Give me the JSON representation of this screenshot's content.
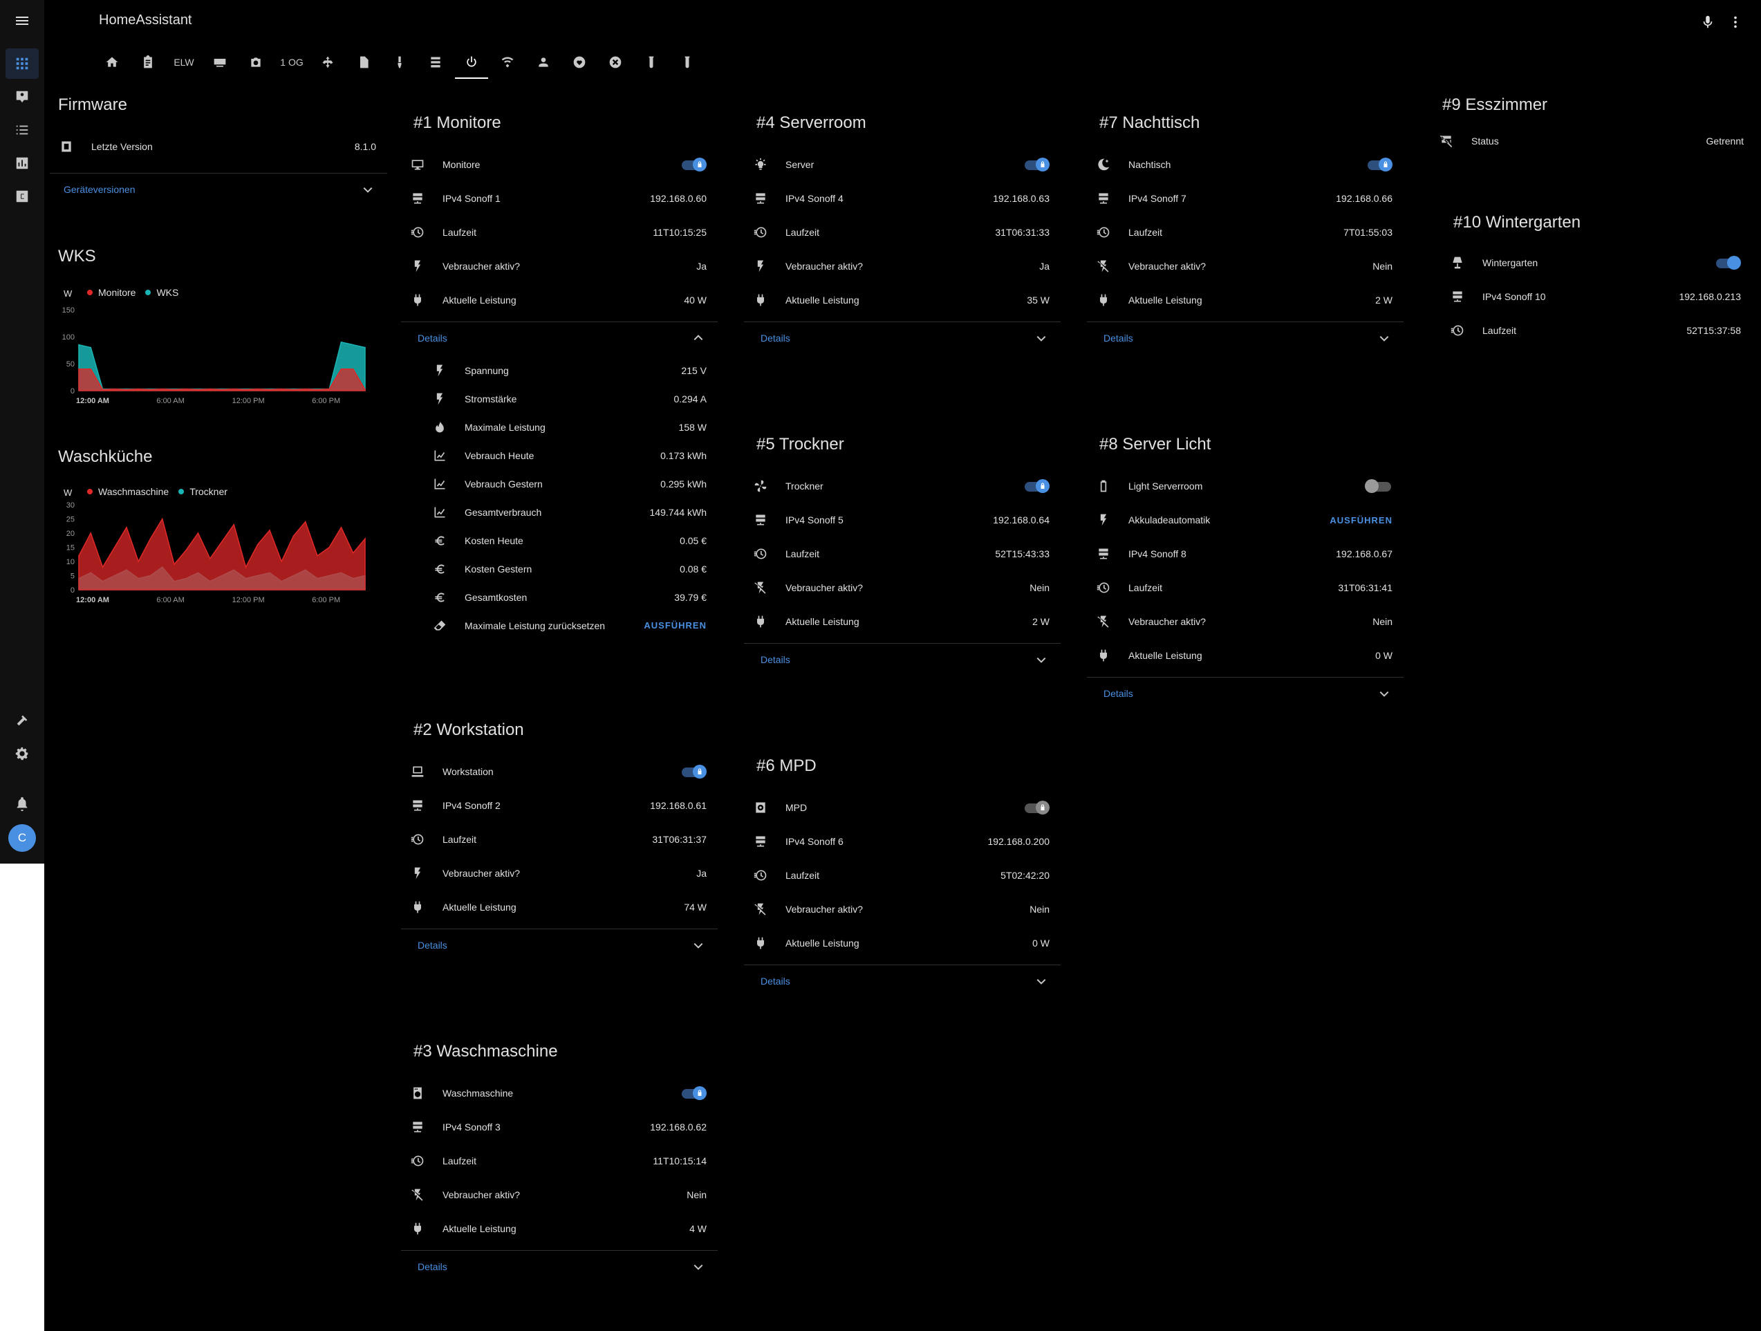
{
  "app": {
    "title": "HomeAssistant"
  },
  "tabs": [
    {
      "name": "tab-home",
      "icon": "home-icon"
    },
    {
      "name": "tab-clipboard",
      "icon": "clipboard-icon"
    },
    {
      "name": "tab-elw",
      "label": "ELW"
    },
    {
      "name": "tab-media",
      "icon": "media-player-icon"
    },
    {
      "name": "tab-camera",
      "icon": "camera-icon"
    },
    {
      "name": "tab-1og",
      "label": "1 OG"
    },
    {
      "name": "tab-network",
      "icon": "network-icon"
    },
    {
      "name": "tab-file",
      "icon": "file-icon"
    },
    {
      "name": "tab-brush",
      "icon": "brush-icon"
    },
    {
      "name": "tab-server",
      "icon": "server-icon"
    },
    {
      "name": "tab-power",
      "icon": "power-icon"
    },
    {
      "name": "tab-wifi",
      "icon": "wifi-icon"
    },
    {
      "name": "tab-person",
      "icon": "person-icon"
    },
    {
      "name": "tab-heart",
      "icon": "heart-icon"
    },
    {
      "name": "tab-close",
      "icon": "close-circle-icon"
    },
    {
      "name": "tab-tube1",
      "icon": "test-tube-icon"
    },
    {
      "name": "tab-tube2",
      "icon": "test-tube-icon"
    }
  ],
  "firmware": {
    "title": "Firmware",
    "latest_label": "Letzte Version",
    "latest_value": "8.1.0",
    "versions_link": "Geräteversionen"
  },
  "wks_chart": {
    "title": "WKS",
    "unit": "W",
    "legend": [
      "Monitore",
      "WKS"
    ]
  },
  "waschkueche_chart": {
    "title": "Waschküche",
    "unit": "W",
    "legend": [
      "Waschmaschine",
      "Trockner"
    ]
  },
  "chart_data": [
    {
      "type": "area",
      "title": "WKS",
      "ylabel": "W",
      "ylim": [
        0,
        150
      ],
      "yticks": [
        "150",
        "100",
        "50",
        "0"
      ],
      "xticks": [
        "12:00 AM",
        "6:00 AM",
        "12:00 PM",
        "6:00 PM"
      ],
      "legend_position": "top-left",
      "series": [
        {
          "name": "Monitore",
          "color": "#e02828",
          "x": [
            0,
            1,
            2,
            3,
            4,
            5,
            6,
            7,
            8,
            9,
            10,
            11,
            12,
            13,
            14,
            15,
            16,
            17,
            18,
            19,
            20,
            21,
            22,
            23,
            24
          ],
          "values": [
            40,
            40,
            2,
            3,
            2,
            3,
            2,
            3,
            2,
            3,
            2,
            3,
            2,
            3,
            2,
            3,
            2,
            3,
            2,
            3,
            2,
            3,
            40,
            40,
            2
          ]
        },
        {
          "name": "WKS",
          "color": "#1ab4b4",
          "x": [
            0,
            1,
            2,
            3,
            4,
            5,
            6,
            7,
            8,
            9,
            10,
            11,
            12,
            13,
            14,
            15,
            16,
            17,
            18,
            19,
            20,
            21,
            22,
            23,
            24
          ],
          "values": [
            85,
            80,
            3,
            3,
            3,
            3,
            3,
            3,
            3,
            3,
            3,
            3,
            3,
            3,
            3,
            3,
            3,
            3,
            3,
            3,
            3,
            3,
            90,
            85,
            80
          ]
        }
      ]
    },
    {
      "type": "area",
      "title": "Waschküche",
      "ylabel": "W",
      "ylim": [
        0,
        30
      ],
      "yticks": [
        "30",
        "25",
        "20",
        "15",
        "10",
        "5",
        "0"
      ],
      "xticks": [
        "12:00 AM",
        "6:00 AM",
        "12:00 PM",
        "6:00 PM"
      ],
      "legend_position": "top-left",
      "series": [
        {
          "name": "Waschmaschine",
          "color": "#e02828",
          "x": [
            0,
            1,
            2,
            3,
            4,
            5,
            6,
            7,
            8,
            9,
            10,
            11,
            12,
            13,
            14,
            15,
            16,
            17,
            18,
            19,
            20,
            21,
            22,
            23,
            24
          ],
          "values": [
            12,
            20,
            8,
            15,
            22,
            10,
            18,
            25,
            9,
            14,
            20,
            11,
            17,
            23,
            8,
            16,
            21,
            10,
            19,
            24,
            12,
            15,
            22,
            13,
            18
          ]
        },
        {
          "name": "Trockner",
          "color": "#1ab4b4",
          "x": [
            0,
            1,
            2,
            3,
            4,
            5,
            6,
            7,
            8,
            9,
            10,
            11,
            12,
            13,
            14,
            15,
            16,
            17,
            18,
            19,
            20,
            21,
            22,
            23,
            24
          ],
          "values": [
            4,
            6,
            3,
            5,
            7,
            4,
            5,
            8,
            3,
            4,
            6,
            3,
            5,
            7,
            4,
            5,
            6,
            3,
            5,
            7,
            4,
            5,
            6,
            4,
            5
          ]
        }
      ]
    }
  ],
  "cards": {
    "c1": {
      "title": "#1 Monitore",
      "rows": [
        {
          "icon": "monitor-icon",
          "label": "Monitore",
          "type": "toggle",
          "state": "on"
        },
        {
          "icon": "ip-network-icon",
          "label": "IPv4 Sonoff 1",
          "value": "192.168.0.60"
        },
        {
          "icon": "clock-icon",
          "label": "Laufzeit",
          "value": "11T10:15:25"
        },
        {
          "icon": "flash-icon",
          "label": "Vebraucher aktiv?",
          "value": "Ja"
        },
        {
          "icon": "power-plug-icon",
          "label": "Aktuelle Leistung",
          "value": "40 W"
        }
      ],
      "details": "Details",
      "sub": [
        {
          "icon": "flash-icon",
          "label": "Spannung",
          "value": "215 V"
        },
        {
          "icon": "flash-icon",
          "label": "Stromstärke",
          "value": "0.294 A"
        },
        {
          "icon": "fire-icon",
          "label": "Maximale Leistung",
          "value": "158 W"
        },
        {
          "icon": "chart-line-icon",
          "label": "Vebrauch Heute",
          "value": "0.173 kWh"
        },
        {
          "icon": "chart-line-icon",
          "label": "Vebrauch Gestern",
          "value": "0.295 kWh"
        },
        {
          "icon": "chart-line-icon",
          "label": "Gesamtverbrauch",
          "value": "149.744 kWh"
        },
        {
          "icon": "euro-icon",
          "label": "Kosten Heute",
          "value": "0.05 €"
        },
        {
          "icon": "euro-icon",
          "label": "Kosten Gestern",
          "value": "0.08 €"
        },
        {
          "icon": "euro-icon",
          "label": "Gesamtkosten",
          "value": "39.79 €"
        },
        {
          "icon": "eraser-icon",
          "label": "Maximale Leistung zurücksetzen",
          "action": "AUSFÜHREN"
        }
      ]
    },
    "c2": {
      "title": "#2 Workstation",
      "rows": [
        {
          "icon": "desktop-icon",
          "label": "Workstation",
          "type": "toggle",
          "state": "on"
        },
        {
          "icon": "ip-network-icon",
          "label": "IPv4 Sonoff 2",
          "value": "192.168.0.61"
        },
        {
          "icon": "clock-icon",
          "label": "Laufzeit",
          "value": "31T06:31:37"
        },
        {
          "icon": "flash-icon",
          "label": "Vebraucher aktiv?",
          "value": "Ja"
        },
        {
          "icon": "power-plug-icon",
          "label": "Aktuelle Leistung",
          "value": "74 W"
        }
      ],
      "details": "Details"
    },
    "c3": {
      "title": "#3 Waschmaschine",
      "rows": [
        {
          "icon": "washing-machine-icon",
          "label": "Waschmaschine",
          "type": "toggle",
          "state": "on"
        },
        {
          "icon": "ip-network-icon",
          "label": "IPv4 Sonoff 3",
          "value": "192.168.0.62"
        },
        {
          "icon": "clock-icon",
          "label": "Laufzeit",
          "value": "11T10:15:14"
        },
        {
          "icon": "flash-off-icon",
          "label": "Vebraucher aktiv?",
          "value": "Nein"
        },
        {
          "icon": "power-plug-icon",
          "label": "Aktuelle Leistung",
          "value": "4 W"
        }
      ],
      "details": "Details"
    },
    "c4": {
      "title": "#4 Serverroom",
      "rows": [
        {
          "icon": "lightbulb-icon",
          "label": "Server",
          "type": "toggle",
          "state": "on"
        },
        {
          "icon": "ip-network-icon",
          "label": "IPv4 Sonoff 4",
          "value": "192.168.0.63"
        },
        {
          "icon": "clock-icon",
          "label": "Laufzeit",
          "value": "31T06:31:33"
        },
        {
          "icon": "flash-icon",
          "label": "Vebraucher aktiv?",
          "value": "Ja"
        },
        {
          "icon": "power-plug-icon",
          "label": "Aktuelle Leistung",
          "value": "35 W"
        }
      ],
      "details": "Details"
    },
    "c5": {
      "title": "#5 Trockner",
      "rows": [
        {
          "icon": "fan-icon",
          "label": "Trockner",
          "type": "toggle",
          "state": "on"
        },
        {
          "icon": "ip-network-icon",
          "label": "IPv4 Sonoff 5",
          "value": "192.168.0.64"
        },
        {
          "icon": "clock-icon",
          "label": "Laufzeit",
          "value": "52T15:43:33"
        },
        {
          "icon": "flash-off-icon",
          "label": "Vebraucher aktiv?",
          "value": "Nein"
        },
        {
          "icon": "power-plug-icon",
          "label": "Aktuelle Leistung",
          "value": "2 W"
        }
      ],
      "details": "Details"
    },
    "c6": {
      "title": "#6 MPD",
      "rows": [
        {
          "icon": "speaker-icon",
          "label": "MPD",
          "type": "toggle",
          "state": "grey"
        },
        {
          "icon": "ip-network-icon",
          "label": "IPv4 Sonoff 6",
          "value": "192.168.0.200"
        },
        {
          "icon": "clock-icon",
          "label": "Laufzeit",
          "value": "5T02:42:20"
        },
        {
          "icon": "flash-off-icon",
          "label": "Vebraucher aktiv?",
          "value": "Nein"
        },
        {
          "icon": "power-plug-icon",
          "label": "Aktuelle Leistung",
          "value": "0 W"
        }
      ],
      "details": "Details"
    },
    "c7": {
      "title": "#7 Nachttisch",
      "rows": [
        {
          "icon": "moon-icon",
          "label": "Nachtisch",
          "type": "toggle",
          "state": "on"
        },
        {
          "icon": "ip-network-icon",
          "label": "IPv4 Sonoff 7",
          "value": "192.168.0.66"
        },
        {
          "icon": "clock-icon",
          "label": "Laufzeit",
          "value": "7T01:55:03"
        },
        {
          "icon": "flash-off-icon",
          "label": "Vebraucher aktiv?",
          "value": "Nein"
        },
        {
          "icon": "power-plug-icon",
          "label": "Aktuelle Leistung",
          "value": "2 W"
        }
      ],
      "details": "Details"
    },
    "c8": {
      "title": "#8 Server Licht",
      "rows": [
        {
          "icon": "battery-icon",
          "label": "Light Serverroom",
          "type": "toggle",
          "state": "off"
        },
        {
          "icon": "flash-icon",
          "label": "Akkuladeautomatik",
          "action": "AUSFÜHREN"
        },
        {
          "icon": "ip-network-icon",
          "label": "IPv4 Sonoff 8",
          "value": "192.168.0.67"
        },
        {
          "icon": "clock-icon",
          "label": "Laufzeit",
          "value": "31T06:31:41"
        },
        {
          "icon": "flash-off-icon",
          "label": "Vebraucher aktiv?",
          "value": "Nein"
        },
        {
          "icon": "power-plug-icon",
          "label": "Aktuelle Leistung",
          "value": "0 W"
        }
      ],
      "details": "Details"
    },
    "c9": {
      "title": "#9 Esszimmer",
      "rows": [
        {
          "icon": "server-off-icon",
          "label": "Status",
          "value": "Getrennt"
        }
      ]
    },
    "c10": {
      "title": "#10 Wintergarten",
      "rows": [
        {
          "icon": "lamp-icon",
          "label": "Wintergarten",
          "type": "toggle",
          "state": "on-plain"
        },
        {
          "icon": "ip-network-icon",
          "label": "IPv4 Sonoff 10",
          "value": "192.168.0.213"
        },
        {
          "icon": "clock-icon",
          "label": "Laufzeit",
          "value": "52T15:37:58"
        }
      ]
    }
  },
  "sidebar": {
    "avatar_initial": "C"
  }
}
